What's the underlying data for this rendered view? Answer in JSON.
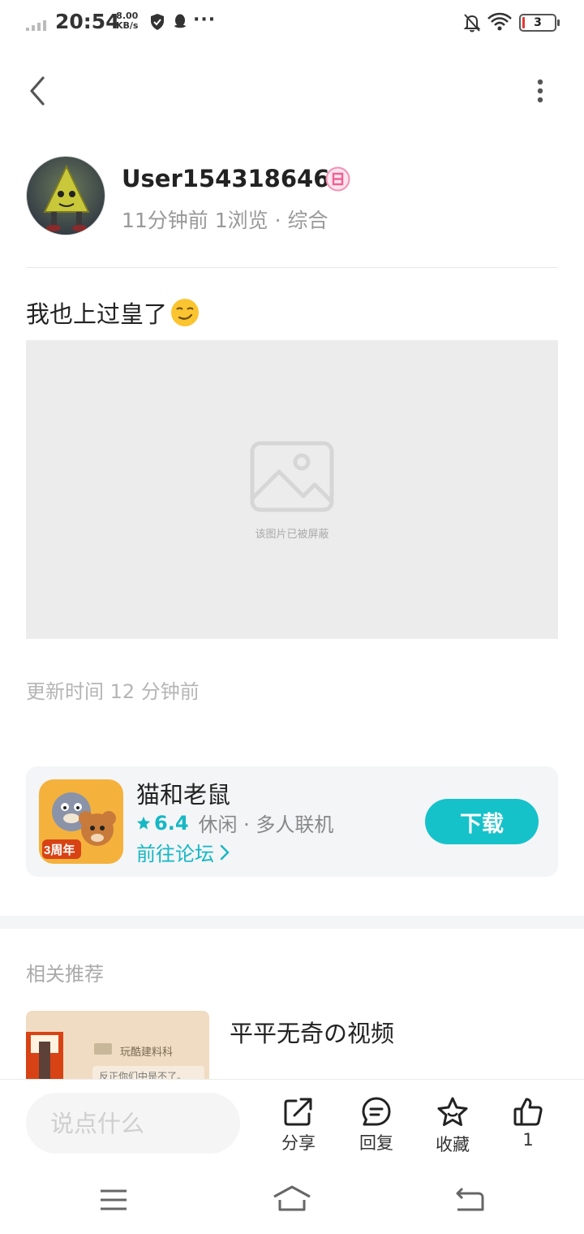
{
  "status_bar": {
    "time": "20:54",
    "net_speed_value": "8.00",
    "net_speed_unit": "KB/s",
    "battery_level": "3",
    "icons": [
      "signal-icon",
      "shield-icon",
      "qq-icon",
      "more-dots-icon",
      "bell-off-icon",
      "wifi-icon",
      "battery-icon"
    ]
  },
  "header": {
    "back_icon": "chevron-left-icon",
    "menu_icon": "more-vertical-icon"
  },
  "author": {
    "name": "User1543186466",
    "level_badge": "level-badge-icon",
    "meta": "11分钟前 1浏览 · 综合"
  },
  "post": {
    "text": "我也上过皇了",
    "emoji": "smirk-emoji-icon",
    "blocked_image_label": "该图片已被屏蔽",
    "update_time": "更新时间 12 分钟前"
  },
  "game_card": {
    "name": "猫和老鼠",
    "rating": "6.4",
    "tags": "休闲 · 多人联机",
    "forum_link": "前往论坛",
    "download_label": "下载",
    "icon_badge": "3周年"
  },
  "related": {
    "section_title": "相关推荐",
    "items": [
      {
        "title": "平平无奇の视频",
        "thumb_tag": "玩酷建料科",
        "thumb_text": "反正你们中是不了。"
      }
    ]
  },
  "bottom_bar": {
    "comment_placeholder": "说点什么",
    "share_label": "分享",
    "reply_label": "回复",
    "favorite_label": "收藏",
    "like_count": "1"
  },
  "colors": {
    "accent": "#16c2c9",
    "accent_text": "#16b7c4",
    "muted_text": "#999999",
    "card_bg": "#f3f5f7"
  }
}
